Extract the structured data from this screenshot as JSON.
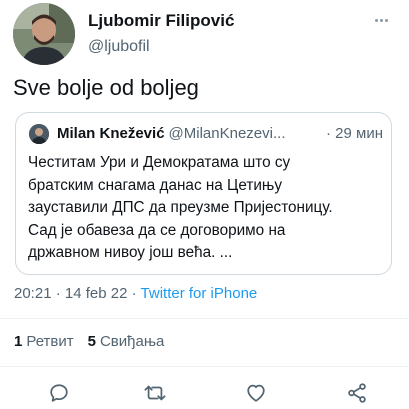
{
  "author": {
    "name": "Ljubomir Filipović",
    "handle": "@ljubofil"
  },
  "tweet": {
    "text": "Sve bolje od boljeg"
  },
  "quoted_tweet": {
    "name": "Milan Knežević",
    "handle": "@MilanKnezevi...",
    "time_sep": "·",
    "time": "29 мин",
    "lines": [
      "Честитам Ури и Демократама што су",
      "братским снагама данас на Цетињу",
      "зауставили ДПС да преузме Пријестоницу.",
      "Сад је обавеза да се договоримо на",
      "државном нивоу још већа. ..."
    ]
  },
  "meta": {
    "time": "20:21",
    "sep1": "·",
    "date": "14 feb 22",
    "sep2": "·",
    "source": "Twitter for iPhone"
  },
  "stats": {
    "retweets_count": "1",
    "retweets_label": "Ретвит",
    "likes_count": "5",
    "likes_label": "Свиђања"
  },
  "colors": {
    "link": "#1d9bf0",
    "secondary_text": "#536471",
    "primary_text": "#0f1419",
    "border": "#cfd9de"
  },
  "icons": {
    "more": "more-icon",
    "reply": "reply-icon",
    "retweet": "retweet-icon",
    "like": "heart-icon",
    "share": "share-icon"
  }
}
